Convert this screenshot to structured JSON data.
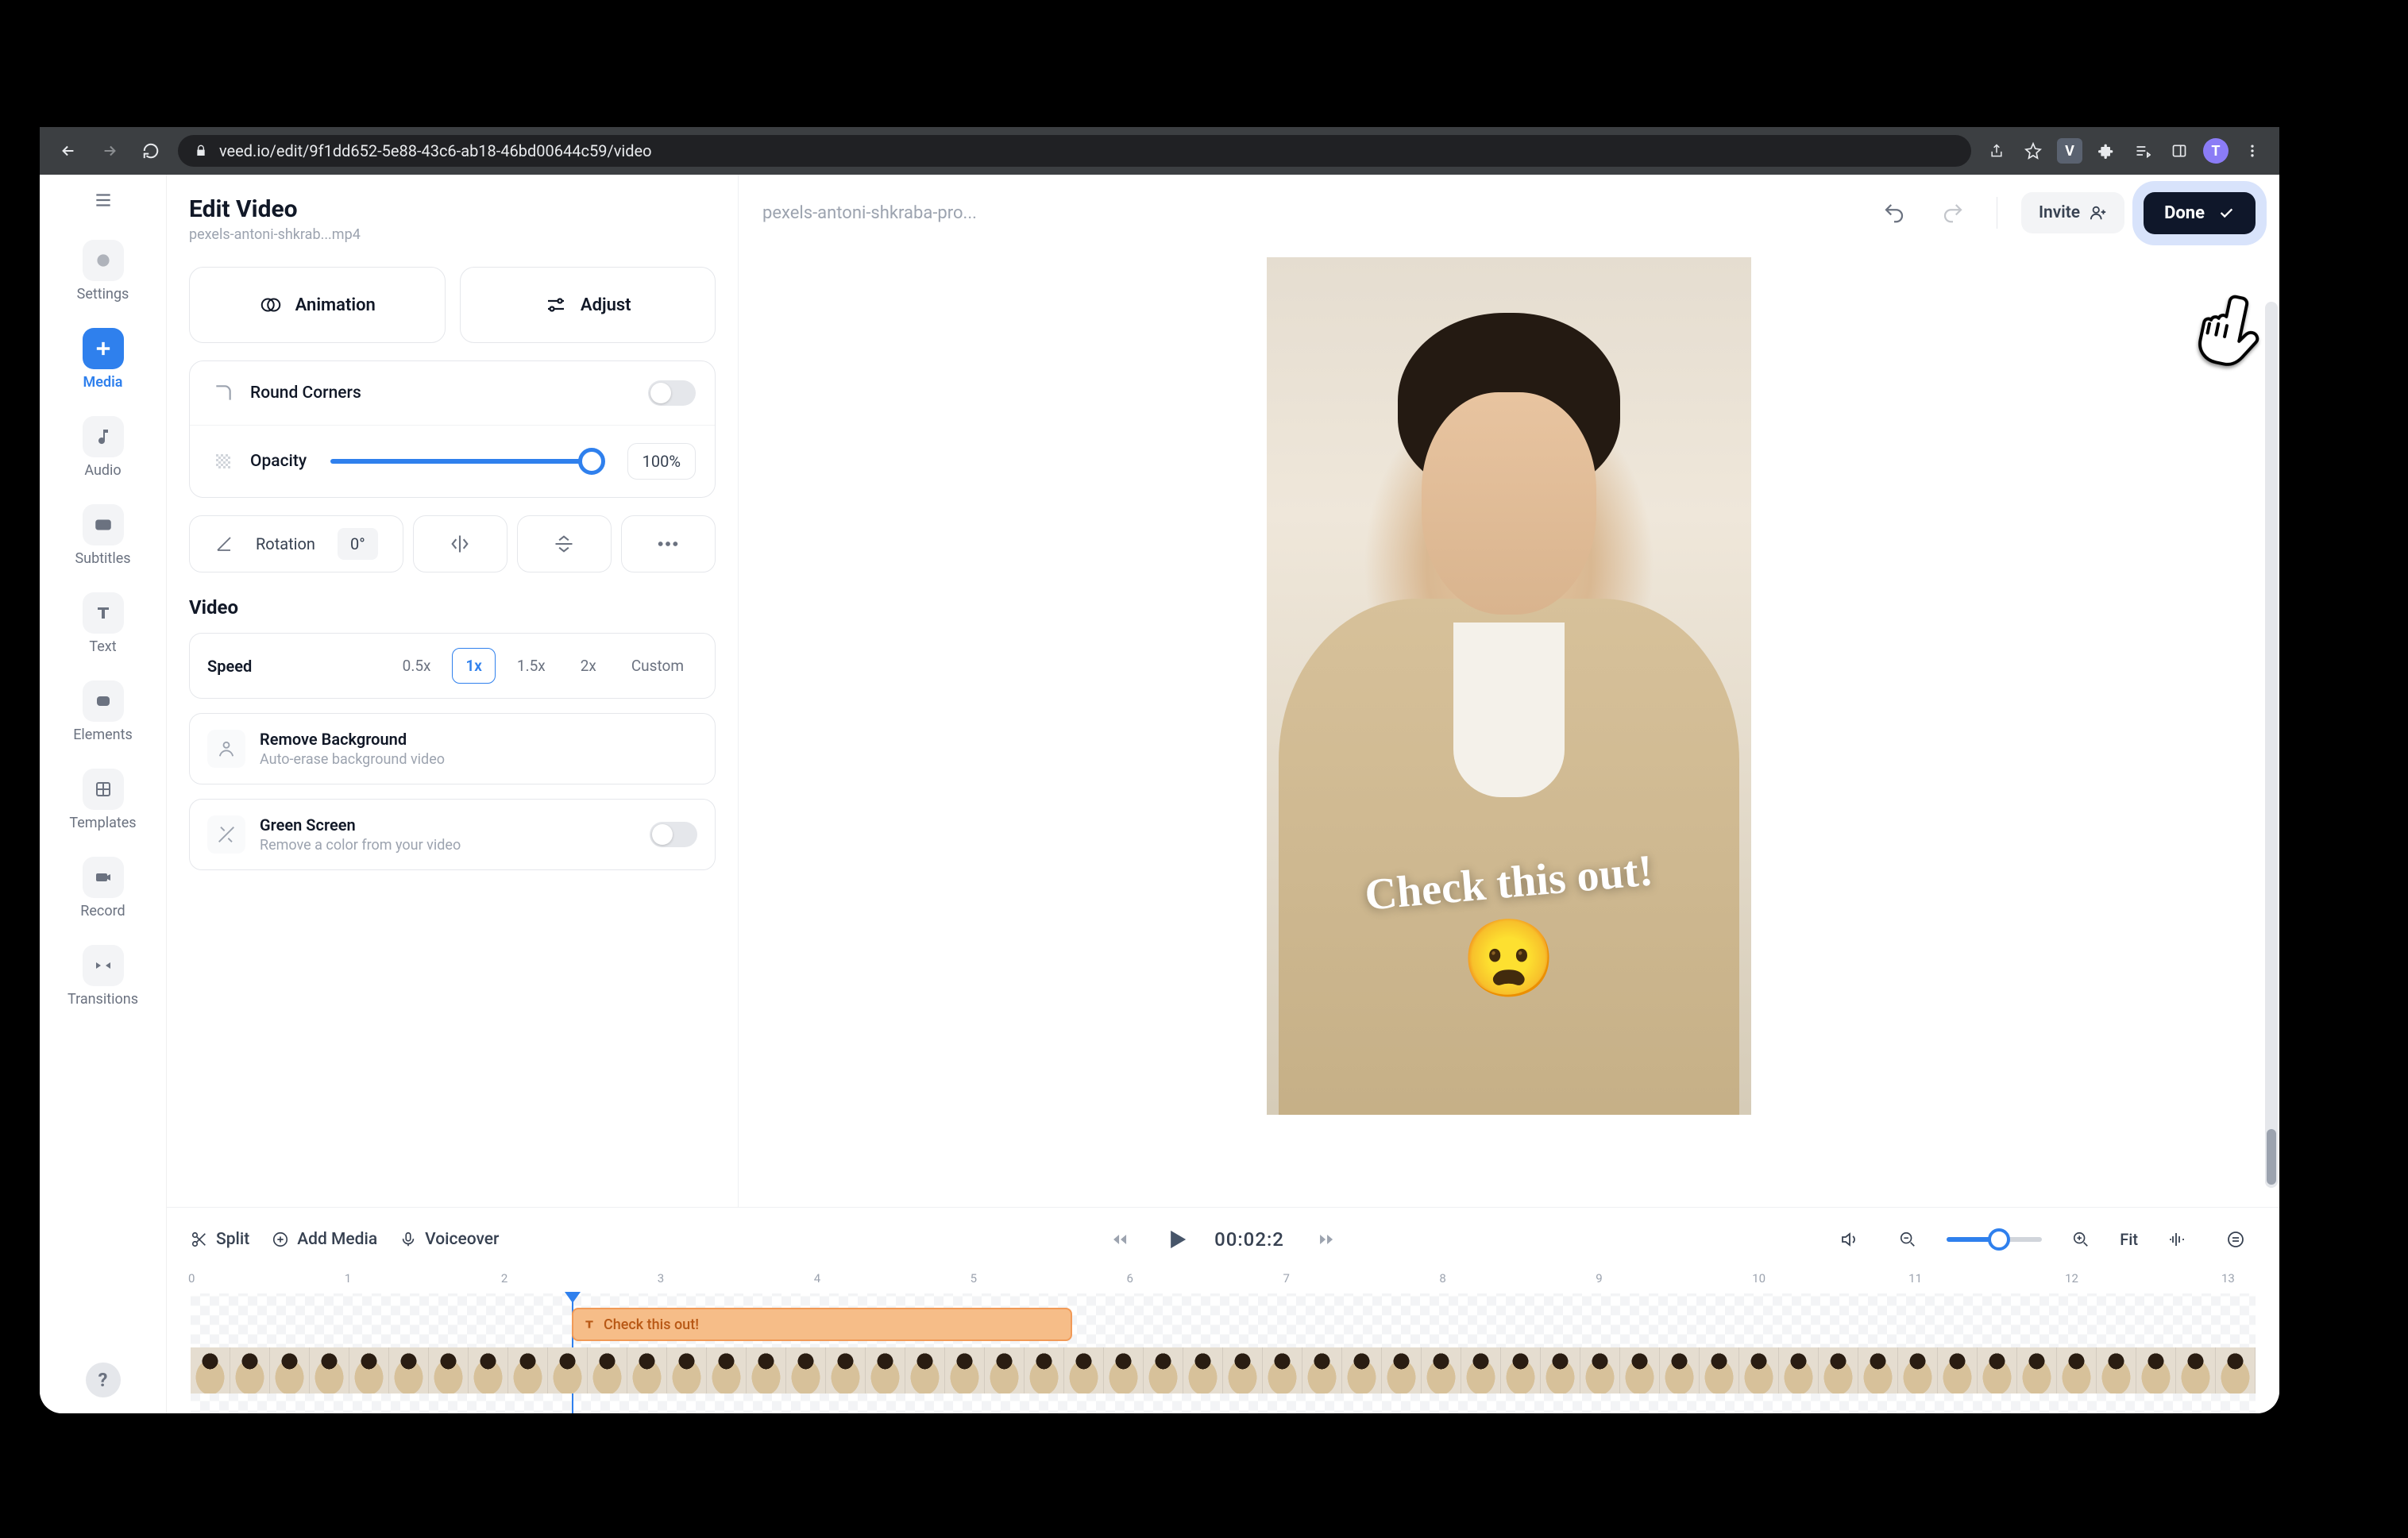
{
  "browser": {
    "url": "veed.io/edit/9f1dd652-5e88-43c6-ab18-46bd00644c59/video",
    "profile_letter": "T",
    "ext_letter": "V"
  },
  "rail": {
    "items": [
      {
        "id": "settings",
        "label": "Settings"
      },
      {
        "id": "media",
        "label": "Media"
      },
      {
        "id": "audio",
        "label": "Audio"
      },
      {
        "id": "subtitles",
        "label": "Subtitles"
      },
      {
        "id": "text",
        "label": "Text"
      },
      {
        "id": "elements",
        "label": "Elements"
      },
      {
        "id": "templates",
        "label": "Templates"
      },
      {
        "id": "record",
        "label": "Record"
      },
      {
        "id": "transitions",
        "label": "Transitions"
      }
    ]
  },
  "panel": {
    "title": "Edit Video",
    "filename": "pexels-antoni-shkrab...mp4",
    "animation": "Animation",
    "adjust": "Adjust",
    "round_corners": "Round Corners",
    "opacity_label": "Opacity",
    "opacity_value": "100%",
    "rotation_label": "Rotation",
    "rotation_value": "0°",
    "video_section": "Video",
    "speed_label": "Speed",
    "speed_opts": [
      "0.5x",
      "1x",
      "1.5x",
      "2x",
      "Custom"
    ],
    "remove_bg_t": "Remove Background",
    "remove_bg_s": "Auto-erase background video",
    "green_t": "Green Screen",
    "green_s": "Remove a color from your video"
  },
  "topbar": {
    "title": "pexels-antoni-shkraba-pro...",
    "invite": "Invite",
    "done": "Done"
  },
  "canvas": {
    "overlay_text": "Check this out!",
    "emoji": "😦"
  },
  "timeline": {
    "split": "Split",
    "add_media": "Add Media",
    "voiceover": "Voiceover",
    "timecode": "00:02:2",
    "fit": "Fit",
    "text_clip": "Check this out!",
    "ruler": [
      "0",
      "1",
      "2",
      "3",
      "4",
      "5",
      "6",
      "7",
      "8",
      "9",
      "10",
      "11",
      "12",
      "13"
    ]
  }
}
